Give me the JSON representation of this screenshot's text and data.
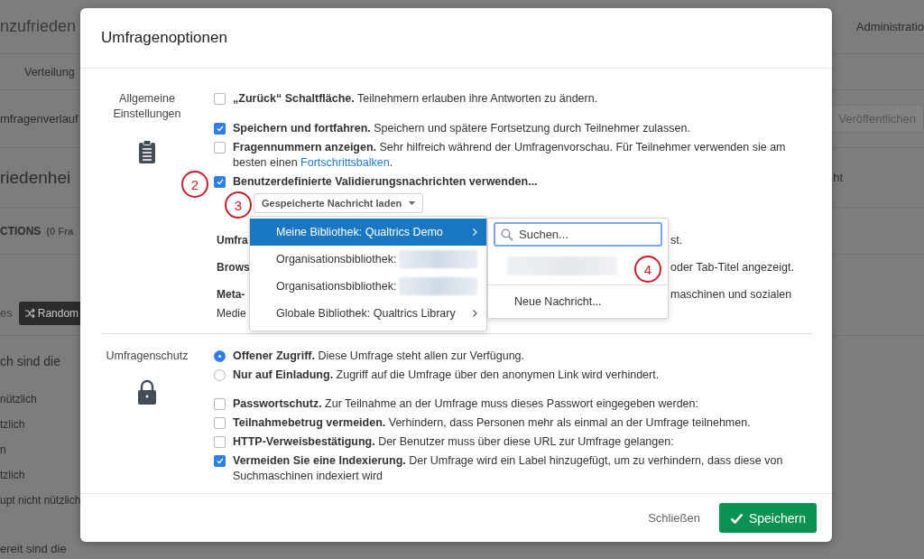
{
  "background": {
    "rows": [
      {
        "kind": "header",
        "left": "nzufrieden",
        "right": "Administratio"
      },
      {
        "kind": "tabs",
        "left": "Verteilung"
      },
      {
        "kind": "toolbar",
        "left": "mfragenverlauf",
        "right": "Veröffentlichen"
      },
      {
        "kind": "title",
        "left": "riedenhei",
        "right": "ht"
      },
      {
        "kind": "block",
        "left": "CTIONS",
        "extra": "(0 Fra"
      },
      {
        "kind": "actions",
        "left": "es",
        "button": "Random"
      },
      {
        "kind": "question",
        "left": "ch sind die"
      },
      {
        "kind": "answer",
        "left": "nützlich"
      },
      {
        "kind": "answer",
        "left": "tzlich"
      },
      {
        "kind": "answer",
        "left": "n"
      },
      {
        "kind": "answer",
        "left": "tzlich"
      },
      {
        "kind": "answer",
        "left": "upt nicht nützlich"
      },
      {
        "kind": "question2",
        "left": "ereit sind die"
      }
    ]
  },
  "dialog": {
    "title": "Umfragenoptionen",
    "sections": [
      {
        "label": "Allgemeine Einstellungen",
        "options": [
          {
            "kind": "checkbox",
            "checked": false,
            "bold": "„Zurück“ Schaltfläche.",
            "text": " Teilnehmern erlauben ihre Antworten zu ändern."
          },
          {
            "kind": "checkbox",
            "checked": true,
            "bold": "Speichern und fortfahren.",
            "text": " Speichern und spätere Fortsetzung durch Teilnehmer zulassen."
          },
          {
            "kind": "checkbox",
            "checked": false,
            "bold": "Fragennummern anzeigen.",
            "text": " Sehr hilfreich während der Umfragenvorschau. Für Teilnehmer verwenden sie am besten einen ",
            "link": "Fortschrittsbalken",
            "after": "."
          },
          {
            "kind": "checkbox",
            "checked": true,
            "bold": "Benutzerdefinierte Validierungsnachrichten verwenden...",
            "button": "Gespeicherte Nachricht laden"
          },
          {
            "kind": "covered",
            "bold": "Umfra",
            "tail": "st."
          },
          {
            "kind": "covered",
            "bold": "Brows",
            "tail": "oder Tab-Titel angezeigt."
          },
          {
            "kind": "covered",
            "bold": "Meta-",
            "tail": "maschinen und sozialen"
          },
          {
            "kind": "covered",
            "text": "Medie"
          }
        ]
      },
      {
        "label": "Umfragenschutz",
        "options": [
          {
            "kind": "radio",
            "selected": true,
            "bold": "Offener Zugriff.",
            "text": " Diese Umfrage steht allen zur Verfügung."
          },
          {
            "kind": "radio",
            "selected": false,
            "bold": "Nur auf Einladung.",
            "text": " Zugriff auf die Umfrage über den anonymen Link wird verhindert."
          },
          {
            "kind": "checkbox",
            "checked": false,
            "bold": "Passwortschutz.",
            "text": " Zur Teilnahme an der Umfrage muss dieses Passwort eingegeben werden:"
          },
          {
            "kind": "checkbox",
            "checked": false,
            "bold": "Teilnahmebetrug vermeiden.",
            "text": " Verhindern, dass Personen mehr als einmal an der Umfrage teilnehmen."
          },
          {
            "kind": "checkbox",
            "checked": false,
            "bold": "HTTP-Verweisbestätigung.",
            "text": " Der Benutzer muss über diese URL zur Umfrage gelangen:"
          },
          {
            "kind": "checkbox",
            "checked": true,
            "bold": "Vermeiden Sie eine Indexierung.",
            "text": " Der Umfrage wird ein Label hinzugefügt, um zu verhindern, dass diese von Suchmaschinen indexiert wird"
          }
        ]
      }
    ],
    "footer": {
      "close": "Schließen",
      "save": "Speichern"
    }
  },
  "menu": {
    "items": [
      {
        "label": "Meine Bibliothek: Qualtrics Demo",
        "selected": true,
        "submenu": true,
        "redacted": false
      },
      {
        "label": "Organisationsbibliothek:",
        "selected": false,
        "submenu": false,
        "redacted": true
      },
      {
        "label": "Organisationsbibliothek:",
        "selected": false,
        "submenu": false,
        "redacted": true
      },
      {
        "label": "Globale Bibliothek: Qualtrics Library",
        "selected": false,
        "submenu": true,
        "redacted": false
      }
    ]
  },
  "submenu": {
    "search": {
      "placeholder": "Suchen..."
    },
    "new_item": "Neue Nachricht..."
  },
  "annotations": [
    {
      "text": "2"
    },
    {
      "text": "3"
    },
    {
      "text": "4"
    }
  ]
}
